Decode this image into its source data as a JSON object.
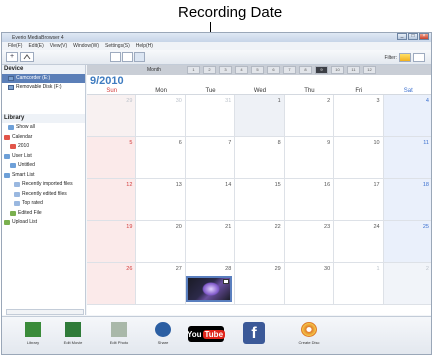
{
  "callout": {
    "label": "Recording Date"
  },
  "window": {
    "title": "Everio MediaBrowser 4",
    "menu": [
      "File(F)",
      "Edit(E)",
      "View(V)",
      "Window(W)",
      "Settings(S)",
      "Help(H)"
    ],
    "controls": [
      "_",
      "□",
      "×"
    ]
  },
  "toolbar": {
    "add_label": "+",
    "filter_label": "Filter:"
  },
  "sidebar": {
    "device_header": "Device",
    "devices": [
      {
        "label": "Camcorder (E:)",
        "selected": true
      },
      {
        "label": "Removable Disk (F:)",
        "selected": false
      }
    ],
    "library_header": "Library",
    "library": [
      {
        "label": "Show all",
        "color": "#6ea0d8"
      },
      {
        "label": "Calendar",
        "color": "#e2554a"
      },
      {
        "label": "2010",
        "color": "#e2554a"
      },
      {
        "label": "User List",
        "color": "#6ea0d8"
      },
      {
        "label": "Untitled",
        "color": "#6ea0d8"
      },
      {
        "label": "Smart List",
        "color": "#6ea0d8"
      },
      {
        "label": "Recently imported files",
        "color": "#9ab8e0"
      },
      {
        "label": "Recently edited files",
        "color": "#9ab8e0"
      },
      {
        "label": "Top rated",
        "color": "#9ab8e0"
      },
      {
        "label": "Edited File",
        "color": "#7ab04f"
      },
      {
        "label": "Upload List",
        "color": "#7ab04f"
      }
    ]
  },
  "calendar": {
    "mode_label": "Month",
    "month_cells": [
      "1",
      "2",
      "3",
      "4",
      "5",
      "6",
      "7",
      "8",
      "9",
      "10",
      "11",
      "12"
    ],
    "active_month": "9",
    "month_label": "9/2010",
    "weekdays": [
      "Sun",
      "Mon",
      "Tue",
      "Wed",
      "Thu",
      "Fri",
      "Sat"
    ],
    "weeks": [
      [
        "29",
        "30",
        "31",
        "1",
        "2",
        "3",
        "4"
      ],
      [
        "5",
        "6",
        "7",
        "8",
        "9",
        "10",
        "11"
      ],
      [
        "12",
        "13",
        "14",
        "15",
        "16",
        "17",
        "18"
      ],
      [
        "19",
        "20",
        "21",
        "22",
        "23",
        "24",
        "25"
      ],
      [
        "26",
        "27",
        "28",
        "29",
        "30",
        "1",
        "2"
      ]
    ],
    "other_month_cells": [
      [
        0,
        0
      ],
      [
        0,
        1
      ],
      [
        0,
        2
      ],
      [
        4,
        5
      ],
      [
        4,
        6
      ]
    ],
    "thumbnail_date": "28"
  },
  "bottom": {
    "actions": [
      {
        "label": "Library",
        "color": "#3a8b3a"
      },
      {
        "label": "Edit Movie",
        "color": "#2f7b39"
      },
      {
        "label": "Edit Photo",
        "color": "#a9b8a9"
      },
      {
        "label": "Share",
        "color": "#2c5fa3"
      },
      {
        "label": "Create Disc",
        "color": "#e07b2a"
      }
    ],
    "youtube_you": "You",
    "youtube_tube": "Tube",
    "facebook_f": "f"
  }
}
